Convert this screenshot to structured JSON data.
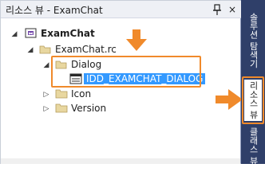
{
  "panel": {
    "title": "리소스 뷰 - ExamChat",
    "close_glyph": "×"
  },
  "tree": {
    "root": "ExamChat",
    "rc": "ExamChat.rc",
    "dialog_folder": "Dialog",
    "dialog_item": "IDD_EXAMCHAT_DIALOG",
    "icon_folder": "Icon",
    "version_folder": "Version"
  },
  "sidebar": {
    "tabs": [
      "솔루션 탐색기",
      "리소스 뷰",
      "클래스 뷰"
    ]
  },
  "colors": {
    "selection": "#3399ff",
    "highlight": "#f08a2b",
    "sidebar": "#2f3f69"
  }
}
